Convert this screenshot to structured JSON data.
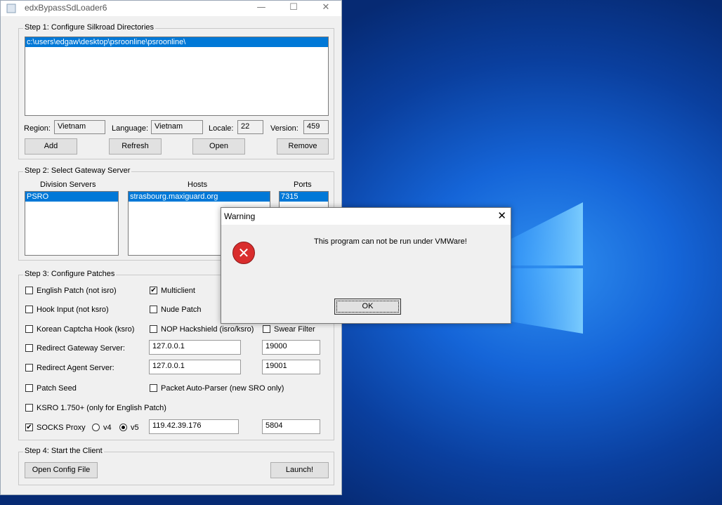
{
  "window": {
    "title": "edxBypassSdLoader6",
    "minimize": "—",
    "maximize": "☐",
    "close": "✕"
  },
  "step1": {
    "legend": "Step 1: Configure Silkroad Directories",
    "directories": [
      "c:\\users\\edgaw\\desktop\\psroonline\\psroonline\\"
    ],
    "region_label": "Region:",
    "region_value": "Vietnam",
    "language_label": "Language:",
    "language_value": "Vietnam",
    "locale_label": "Locale:",
    "locale_value": "22",
    "version_label": "Version:",
    "version_value": "459",
    "add": "Add",
    "refresh": "Refresh",
    "open": "Open",
    "remove": "Remove"
  },
  "step2": {
    "legend": "Step 2: Select Gateway Server",
    "col_division": "Division Servers",
    "col_hosts": "Hosts",
    "col_ports": "Ports",
    "division": "PSRO",
    "host": "strasbourg.maxiguard.org",
    "port": "7315"
  },
  "step3": {
    "legend": "Step 3: Configure Patches",
    "english_patch": "English Patch (not isro)",
    "multiclient": "Multiclient",
    "hook_input": "Hook Input (not ksro)",
    "nude_patch": "Nude Patch",
    "korean_captcha": "Korean Captcha Hook (ksro)",
    "nop_hackshield": "NOP Hackshield (isro/ksro)",
    "swear_filter": "Swear Filter",
    "redirect_gateway": "Redirect Gateway Server:",
    "gateway_ip": "127.0.0.1",
    "gateway_port": "19000",
    "redirect_agent": "Redirect Agent Server:",
    "agent_ip": "127.0.0.1",
    "agent_port": "19001",
    "patch_seed": "Patch Seed",
    "packet_parser": "Packet Auto-Parser (new SRO only)",
    "ksro": "KSRO 1.750+ (only for English Patch)",
    "socks": "SOCKS Proxy",
    "v4": "v4",
    "v5": "v5",
    "proxy_ip": "119.42.39.176",
    "proxy_port": "5804",
    "check_mark": "✔"
  },
  "step4": {
    "legend": "Step 4: Start the Client",
    "open_config": "Open Config File",
    "launch": "Launch!"
  },
  "dialog": {
    "title": "Warning",
    "message": "This program can not be run under VMWare!",
    "ok": "OK",
    "close": "✕",
    "icon": "✕"
  }
}
